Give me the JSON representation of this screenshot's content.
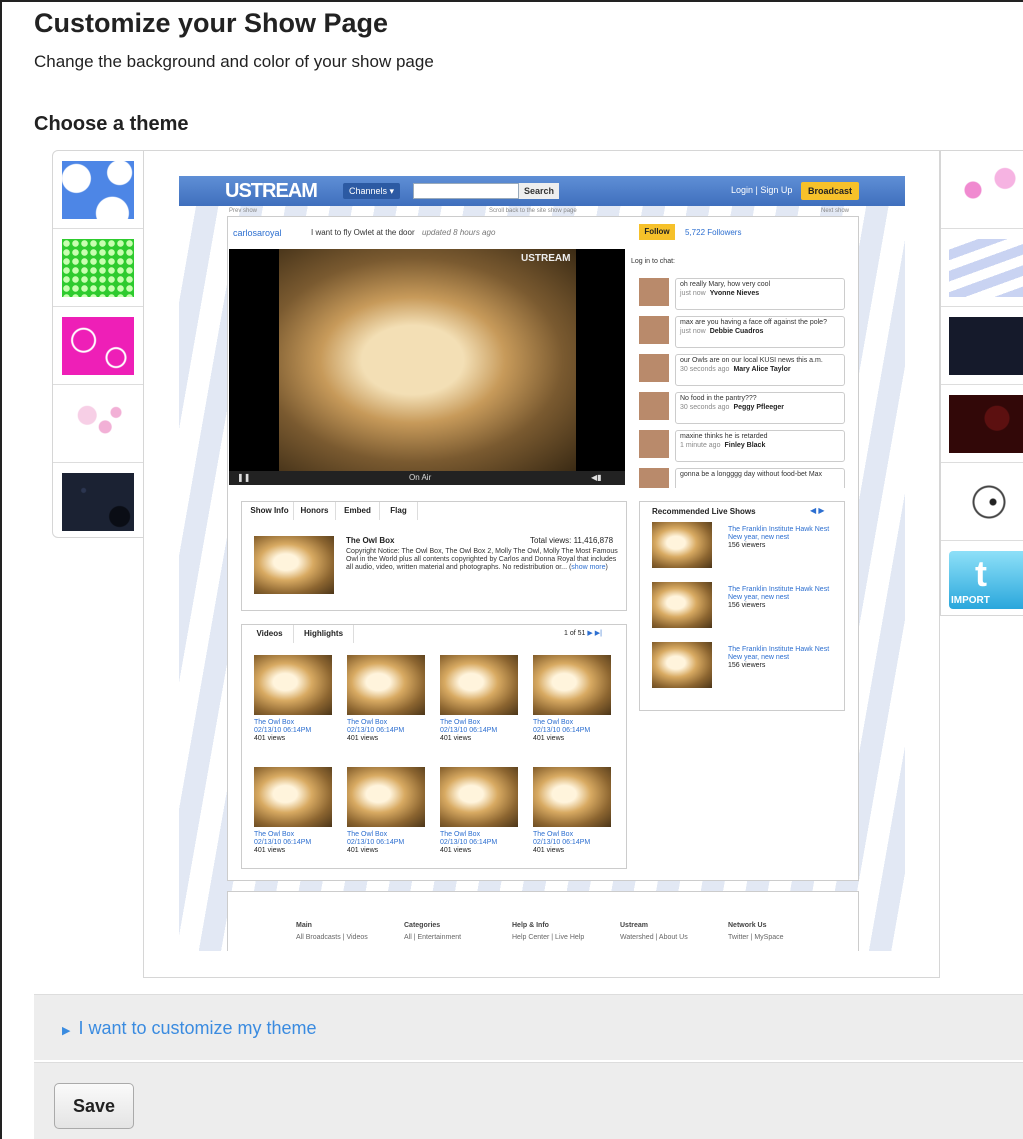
{
  "page": {
    "title": "Customize your Show Page",
    "subtitle": "Change the background and color of your show page",
    "section_title": "Choose a theme"
  },
  "themes_left": [
    {
      "name": "clouds-theme",
      "colors": [
        "#4d86e6",
        "#ffffff"
      ]
    },
    {
      "name": "green-dots-theme",
      "colors": [
        "#2ecb2e",
        "#c8ffb0"
      ]
    },
    {
      "name": "pink-swirl-theme",
      "colors": [
        "#ee1fb7",
        "#ffffff"
      ]
    },
    {
      "name": "light-pink-floral-theme",
      "colors": [
        "#ffffff",
        "#f2b0d6"
      ]
    },
    {
      "name": "dark-splatter-theme",
      "colors": [
        "#1b2233",
        "#0a0d15"
      ]
    }
  ],
  "themes_right": [
    {
      "name": "pink-floral-theme",
      "colors": [
        "#ffffff",
        "#f08ad0"
      ]
    },
    {
      "name": "blue-rays-theme",
      "colors": [
        "#ffffff",
        "#c9d3f2"
      ]
    },
    {
      "name": "dark-navy-theme",
      "colors": [
        "#151a2b",
        "#1f2740"
      ]
    },
    {
      "name": "dark-red-theme",
      "colors": [
        "#320808",
        "#4a0d0d"
      ]
    },
    {
      "name": "black-ink-theme",
      "colors": [
        "#ffffff",
        "#222222"
      ]
    },
    {
      "name": "twitter-import-theme",
      "colors": [
        "#6ad0f0",
        "#2aa7dc"
      ],
      "label": "IMPORT"
    }
  ],
  "preview": {
    "logo": "USTREAM",
    "channels": "Channels ▾",
    "search": "Search",
    "login": "Login | Sign Up",
    "broadcast": "Broadcast",
    "prev_show": "Prev show",
    "back_link": "Scroll back to the site show page",
    "next_show": "Next show",
    "channel_name": "carlosaroyal",
    "status": "I want to fly Owlet at the door",
    "updated": "updated 8 hours ago",
    "follow": "Follow",
    "followers": "5,722 Followers",
    "login_chat": "Log in to chat:",
    "video_watermark": "USTREAM",
    "on_air": "On Air",
    "chat": [
      {
        "text": "oh really Mary, how very cool",
        "meta": "just now",
        "user": "Yvonne Nieves"
      },
      {
        "text": "max are you having a face off against the pole?",
        "meta": "just now",
        "user": "Debbie Cuadros"
      },
      {
        "text": "our Owls are on our local KUSI news this a.m.",
        "meta": "30 seconds ago",
        "user": "Mary Alice Taylor"
      },
      {
        "text": "No food in the pantry???",
        "meta": "30 seconds ago",
        "user": "Peggy Pfleeger"
      },
      {
        "text": "maxine thinks he is retarded",
        "meta": "1 minute ago",
        "user": "Finley Black"
      },
      {
        "text": "gonna be a longggg day without food-bet Max",
        "meta": "",
        "user": ""
      }
    ],
    "info_tabs": [
      "Show Info",
      "Honors",
      "Embed",
      "Flag"
    ],
    "show_title": "The Owl Box",
    "total_views": "Total views: 11,416,878",
    "description": "Copyright Notice: The Owl Box, The Owl Box 2, Molly The Owl, Molly The Most Famous Owl in the World plus all contents copyrighted by Carlos and Donna Royal that includes all audio, video, written material and photographs. No redistribution or... (",
    "show_more": "show more",
    "show_more_end": ")",
    "rec_title": "Recommended Live Shows",
    "recommended": [
      {
        "title": "The Franklin Institute Hawk Nest",
        "sub": "New year, new nest",
        "viewers": "156 viewers"
      },
      {
        "title": "The Franklin Institute Hawk Nest",
        "sub": "New year, new nest",
        "viewers": "156 viewers"
      },
      {
        "title": "The Franklin Institute Hawk Nest",
        "sub": "New year, new nest",
        "viewers": "156 viewers"
      }
    ],
    "video_tabs": [
      "Videos",
      "Highlights"
    ],
    "pager": "1 of 51",
    "videos": [
      {
        "title": "The Owl Box",
        "date": "02/13/10 06:14PM",
        "views": "401 views"
      },
      {
        "title": "The Owl Box",
        "date": "02/13/10 06:14PM",
        "views": "401 views"
      },
      {
        "title": "The Owl Box",
        "date": "02/13/10 06:14PM",
        "views": "401 views"
      },
      {
        "title": "The Owl Box",
        "date": "02/13/10 06:14PM",
        "views": "401 views"
      },
      {
        "title": "The Owl Box",
        "date": "02/13/10 06:14PM",
        "views": "401 views"
      },
      {
        "title": "The Owl Box",
        "date": "02/13/10 06:14PM",
        "views": "401 views"
      },
      {
        "title": "The Owl Box",
        "date": "02/13/10 06:14PM",
        "views": "401 views"
      },
      {
        "title": "The Owl Box",
        "date": "02/13/10 06:14PM",
        "views": "401 views"
      }
    ],
    "footer": [
      {
        "head": "Main",
        "line": "All Broadcasts | Videos"
      },
      {
        "head": "Categories",
        "line": "All | Entertainment"
      },
      {
        "head": "Help & Info",
        "line": "Help Center | Live Help"
      },
      {
        "head": "Ustream",
        "line": "Watershed | About Us"
      },
      {
        "head": "Network Us",
        "line": "Twitter | MySpace"
      }
    ]
  },
  "customize_link": "I want to customize my theme",
  "save_label": "Save",
  "colors": {
    "accent": "#3a8be0",
    "bar_bg": "#ededed",
    "ustream_blue": "#4a7cc8",
    "broadcast": "#f6c12a"
  }
}
